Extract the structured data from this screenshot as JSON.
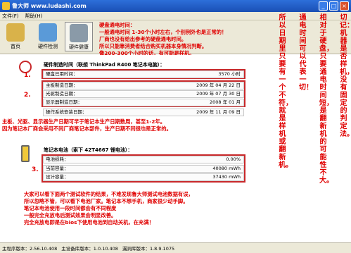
{
  "window": {
    "title": "鲁大师 www.ludashi.com"
  },
  "menu": [
    "文件(F)",
    "帮助(H)"
  ],
  "toolbar": {
    "items": [
      "首页",
      "硬件检测",
      "硬件健康"
    ]
  },
  "annotation_top": [
    "硬盘通电时间：",
    "一般通电时间 1-30个小时左右，个别例外也是正常的！",
    "厂商也没有给出参考的硬盘通电时间。",
    "所以只能靠消费者结合购买机器本身情况判断。",
    "像200-300个小时的话，有可能是样机。"
  ],
  "section1": {
    "header": "硬件制造时间（联想 ThinkPad R400 笔记本电脑）：",
    "rows": [
      {
        "label": "硬盘已用时间：",
        "value": "3570 小时"
      },
      {
        "label": "主板制造日期：",
        "value": "2009 年 04 月 22 日"
      },
      {
        "label": "光驱制造日期：",
        "value": "2009 年 07 月 30 日"
      },
      {
        "label": "显示器制造日期：",
        "value": "2008 年 01 月"
      },
      {
        "label": "操作系统安装日期：",
        "value": "2009 年 11 月 09 日"
      }
    ],
    "num1": "1.",
    "num2": "2."
  },
  "annotation_mid": [
    "主板、光驱、显示器生产日期可早于笔记本生产日期数周，甚至1-2年。",
    "因为笔记本厂商会采用不同厂商笔记本部件，生产日期不同很也是正常的。"
  ],
  "section2": {
    "header": "笔记本电池（索下 42T4667 锂电池）：",
    "rows": [
      {
        "label": "电池损耗：",
        "value": "0.00%"
      },
      {
        "label": "当前容量：",
        "value": "40080 mWh"
      },
      {
        "label": "设计容量：",
        "value": "37430 mWh"
      }
    ],
    "num3": "3."
  },
  "annotation_bottom": [
    "大家可以看下面两个测试软件的结果，不难发现鲁大师测试电池数据有误，",
    "所以忽略不管，可以看下电池厂家。笔记本不想手机，商家很少动手脚。",
    "笔记本电池使用一段时间都会有不同程度",
    "一般完全充放电后测试效果会明显改善。",
    "完全充放电即是在bios下使用电池到自动关机，在充满！"
  ],
  "annotation_right": [
    "所以日期里只要有一个不符，就是样机或翻新机。",
    "通电时间可以代表一切！",
    "相对于硬盘，只要通电时间短，是翻新机的可能性不大。",
    "切记：机器是否样机，没有固定的判定法。"
  ],
  "status": {
    "main": "主程序版本：2.56.10.408",
    "db": "主设备库版本：1.0.10.408",
    "vuln": "漏洞库版本：1.8.9.1075"
  },
  "colors": {
    "annotation": "#e00000",
    "box": "#c8282a",
    "titlebar": "#2d6fd9"
  }
}
